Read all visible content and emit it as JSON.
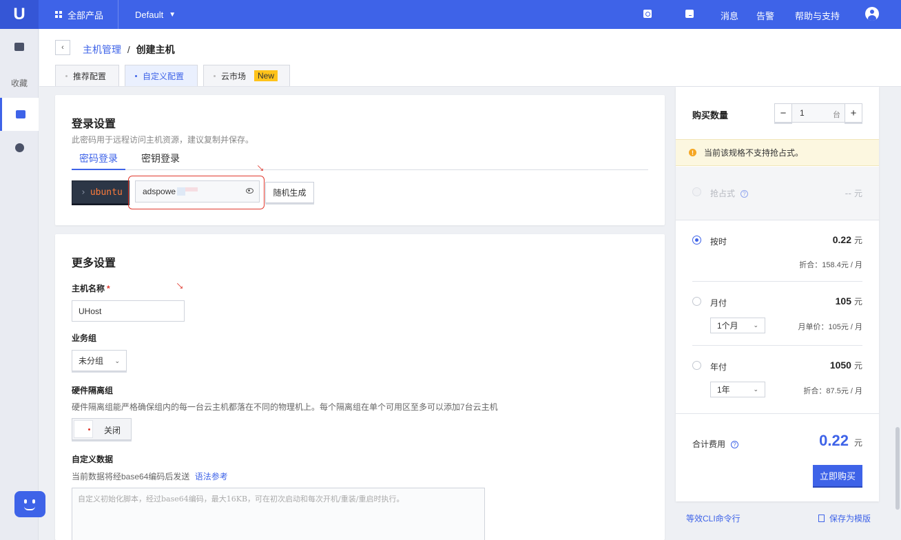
{
  "topbar": {
    "logo": "U",
    "all_products": "全部产品",
    "project": "Default",
    "icons": [
      "search-icon",
      "terminal-icon"
    ],
    "links": [
      "消息",
      "告警",
      "帮助与支持"
    ]
  },
  "sidebar": {
    "favorites": "收藏"
  },
  "breadcrumb": {
    "parent": "主机管理",
    "separator": "/",
    "current": "创建主机"
  },
  "tabs": [
    {
      "label": "推荐配置"
    },
    {
      "label": "自定义配置"
    },
    {
      "label": "云市场",
      "badge": "New"
    }
  ],
  "login": {
    "title": "登录设置",
    "hint": "此密码用于远程访问主机资源，建议复制并保存。",
    "tabs": [
      "密码登录",
      "密钥登录"
    ],
    "user_prompt": "›",
    "user": "ubuntu",
    "password": "adspowe",
    "random_button": "随机生成"
  },
  "more": {
    "title": "更多设置",
    "hostname_label": "主机名称",
    "required_mark": "*",
    "hostname_value": "UHost",
    "group_label": "业务组",
    "group_value": "未分组",
    "isolation_label": "硬件隔离组",
    "isolation_hint": "硬件隔离组能严格确保组内的每一台云主机都落在不同的物理机上。每个隔离组在单个可用区至多可以添加7台云主机",
    "isolation_toggle": "关闭",
    "userdata_label": "自定义数据",
    "userdata_hint": "当前数据将经base64编码后发送",
    "userdata_link": "语法参考",
    "userdata_placeholder": "自定义初始化脚本，经过base64编码，最大16KB，可在初次启动和每次开机/重装/重启时执行。"
  },
  "purchase": {
    "qty_label": "购买数量",
    "qty_minus": "−",
    "qty_value": "1",
    "qty_unit": "台",
    "qty_plus": "+",
    "warning": "当前该规格不支持抢占式。",
    "options": {
      "spot": {
        "label": "抢占式",
        "price": "--",
        "unit": "元"
      },
      "hourly": {
        "label": "按时",
        "price": "0.22",
        "unit": "元",
        "sub": "折合：158.4元 / 月"
      },
      "monthly": {
        "label": "月付",
        "price": "105",
        "unit": "元",
        "select": "1个月",
        "sub": "月单价：105元 / 月"
      },
      "yearly": {
        "label": "年付",
        "price": "1050",
        "unit": "元",
        "select": "1年",
        "sub": "折合：87.5元 / 月"
      }
    },
    "total_label": "合计费用",
    "total_value": "0.22",
    "total_unit": "元",
    "buy_button": "立即购买"
  },
  "footer": {
    "cli_link": "等效CLI命令行",
    "template_link": "保存为模版"
  },
  "colors": {
    "primary": "#3e63e8",
    "danger": "#e0372c",
    "warning_bg": "#fcf7e0"
  }
}
